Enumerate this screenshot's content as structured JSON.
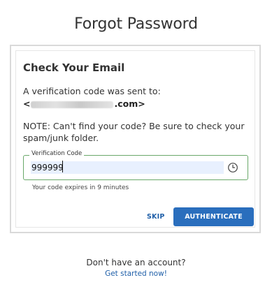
{
  "page": {
    "title": "Forgot Password"
  },
  "card": {
    "heading": "Check Your Email",
    "sent_text": "A verification code was sent to:",
    "email_prefix": "<",
    "email_suffix": ".com>",
    "note": "NOTE: Can't find your code? Be sure to check your spam/junk folder."
  },
  "verification": {
    "label": "Verification Code",
    "value": "999999",
    "expires": "Your code expires in 9 minutes",
    "icon": "clock-icon"
  },
  "actions": {
    "skip_label": "SKIP",
    "authenticate_label": "AUTHENTICATE"
  },
  "footer": {
    "no_account": "Don't have an account?",
    "get_started": "Get started now!"
  },
  "colors": {
    "accent": "#2a6ebd",
    "link": "#1f5fa8",
    "field_border": "#6aa86a",
    "autofill_bg": "#e8f0fe"
  }
}
